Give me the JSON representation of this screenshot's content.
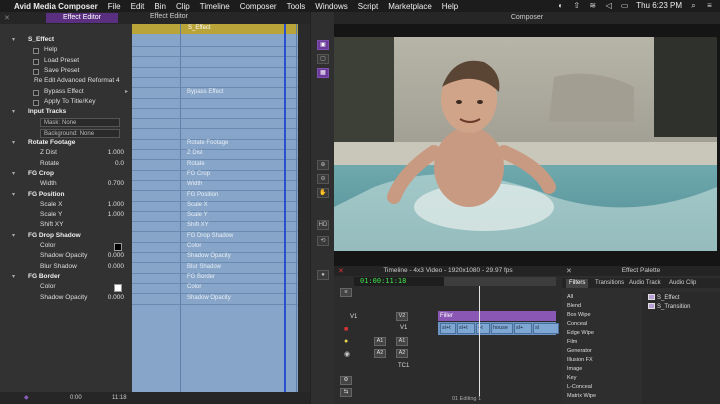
{
  "menubar": {
    "apple": "",
    "app": "Avid Media Composer",
    "items": [
      "File",
      "Edit",
      "Bin",
      "Clip",
      "Timeline",
      "Composer",
      "Tools",
      "Windows",
      "Script",
      "Marketplace",
      "Help"
    ],
    "clock": "Thu 6:23 PM"
  },
  "effect_editor": {
    "tab": "Effect Editor",
    "window_title": "Effect Editor",
    "track_header": "S_Effect",
    "rows": [
      {
        "label": "S_Effect",
        "type": "group"
      },
      {
        "label": "Help",
        "type": "check"
      },
      {
        "label": "Load Preset",
        "type": "check"
      },
      {
        "label": "Save Preset",
        "type": "check"
      },
      {
        "label": "Re Edit Advanced Reformat 4",
        "type": "plain"
      },
      {
        "label": "Bypass Effect",
        "type": "check"
      },
      {
        "label": "Apply To Title/Key",
        "type": "check"
      },
      {
        "label": "Input Tracks",
        "type": "group"
      },
      {
        "label": "Mask:",
        "value": "None",
        "type": "dropdown"
      },
      {
        "label": "Background:",
        "value": "None",
        "type": "dropdown"
      },
      {
        "label": "Rotate Footage",
        "type": "group"
      },
      {
        "label": "Z Dist",
        "value": "1.000",
        "type": "param"
      },
      {
        "label": "Rotate",
        "value": "0.0",
        "type": "param"
      },
      {
        "label": "FG Crop",
        "type": "group"
      },
      {
        "label": "Width",
        "value": "0.700",
        "type": "param"
      },
      {
        "label": "FG Position",
        "type": "group"
      },
      {
        "label": "Scale X",
        "value": "1.000",
        "type": "param"
      },
      {
        "label": "Scale Y",
        "value": "1.000",
        "type": "param"
      },
      {
        "label": "Shift XY",
        "type": "param"
      },
      {
        "label": "FG Drop Shadow",
        "type": "group"
      },
      {
        "label": "Color",
        "type": "color",
        "color": "#000000"
      },
      {
        "label": "Shadow Opacity",
        "value": "0.000",
        "type": "param"
      },
      {
        "label": "Blur Shadow",
        "value": "0.000",
        "type": "param"
      },
      {
        "label": "FG Border",
        "type": "group"
      },
      {
        "label": "Color",
        "type": "color",
        "color": "#ffffff"
      },
      {
        "label": "Shadow Opacity",
        "value": "0.000",
        "type": "param"
      }
    ],
    "track_labels": [
      {
        "text": "Bypass Effect",
        "row": 5
      },
      {
        "text": "Rotate Footage",
        "row": 10
      },
      {
        "text": "Z Dist",
        "row": 11
      },
      {
        "text": "Rotate",
        "row": 12
      },
      {
        "text": "FG Crop",
        "row": 13
      },
      {
        "text": "Width",
        "row": 14
      },
      {
        "text": "FG Position",
        "row": 15
      },
      {
        "text": "Scale X",
        "row": 16
      },
      {
        "text": "Scale Y",
        "row": 17
      },
      {
        "text": "Shift XY",
        "row": 18
      },
      {
        "text": "FG Drop Shadow",
        "row": 19
      },
      {
        "text": "Color",
        "row": 20
      },
      {
        "text": "Shadow Opacity",
        "row": 21
      },
      {
        "text": "Blur Shadow",
        "row": 22
      },
      {
        "text": "FG Border",
        "row": 23
      },
      {
        "text": "Color",
        "row": 24
      },
      {
        "text": "Shadow Opacity",
        "row": 25
      }
    ],
    "bottom_time": "0:00",
    "bottom_time2": "11:18"
  },
  "composer": {
    "title": "Composer"
  },
  "timeline": {
    "title": "Timeline - 4x3 Video - 1920x1080 - 29.97 fps",
    "timecode": "01:00:11:18",
    "tracks": [
      "V1",
      "V2",
      "V1",
      "A1",
      "A1",
      "A2",
      "A2",
      "TC1"
    ],
    "filler": "Filler",
    "clips": [
      "sl+t",
      "sl+t",
      "+t",
      "house",
      "sl+",
      "sl"
    ],
    "sequence": "01 Editing 1"
  },
  "effect_palette": {
    "title": "Effect Palette",
    "tabs": [
      "Filters",
      "Transitions",
      "Audio Track",
      "Audio Clip"
    ],
    "categories": [
      "All",
      "Blend",
      "Box Wipe",
      "Conceal",
      "Edge Wipe",
      "Film",
      "Generator",
      "Illusion FX",
      "Image",
      "Key",
      "L-Conceal",
      "Matrix Wipe"
    ],
    "effects": [
      "S_Effect",
      "S_Transition"
    ]
  },
  "colors": {
    "accent": "#5b2f80",
    "track_blue": "#86a5c8",
    "filler": "#8b57b5",
    "timecode": "#3fe04a"
  }
}
